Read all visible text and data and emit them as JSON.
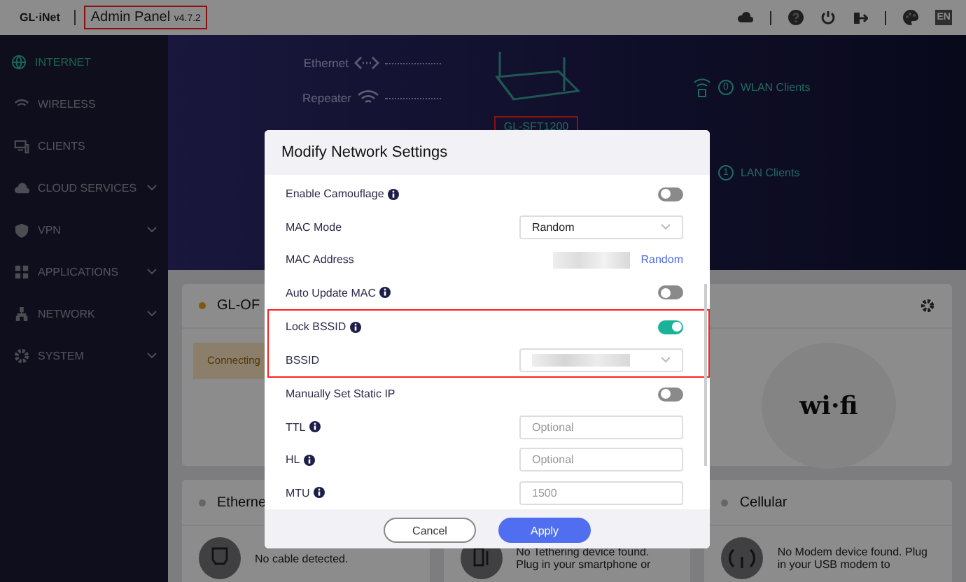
{
  "top_bar": {
    "logo": "GL·iNet",
    "title": "Admin Panel",
    "version": "v4.7.2",
    "highlighted": true,
    "language": "EN"
  },
  "sidebar": {
    "items": [
      {
        "label": "INTERNET",
        "selected": true,
        "expandable": false
      },
      {
        "label": "WIRELESS",
        "selected": false,
        "expandable": false
      },
      {
        "label": "CLIENTS",
        "selected": false,
        "expandable": false
      },
      {
        "label": "CLOUD SERVICES",
        "selected": false,
        "expandable": true
      },
      {
        "label": "VPN",
        "selected": false,
        "expandable": true
      },
      {
        "label": "APPLICATIONS",
        "selected": false,
        "expandable": true
      },
      {
        "label": "NETWORK",
        "selected": false,
        "expandable": true
      },
      {
        "label": "SYSTEM",
        "selected": false,
        "expandable": true
      }
    ]
  },
  "topology": {
    "links": [
      {
        "label": "Ethernet"
      },
      {
        "label": "Repeater"
      }
    ],
    "device": "GL-SFT1200",
    "device_highlighted": true,
    "clients": [
      {
        "count": "0",
        "label": "WLAN Clients"
      },
      {
        "count": "1",
        "label": "LAN Clients"
      }
    ]
  },
  "repeater_card": {
    "title": "GL-OF",
    "status": "Connecting",
    "logo": "wi·fi"
  },
  "panels": [
    {
      "title": "Etherne",
      "message": "No cable detected."
    },
    {
      "message": "No Tethering device found. Plug in your smartphone or"
    },
    {
      "title": "Cellular",
      "message": "No Modem device found. Plug in your USB modem to"
    }
  ],
  "dialog": {
    "title": "Modify Network Settings",
    "rows": [
      {
        "kind": "toggle",
        "label": "Enable Camouflage",
        "info": true,
        "on": false,
        "highlighted": false
      },
      {
        "kind": "select",
        "label": "MAC Mode",
        "value": "Random",
        "highlighted": false
      },
      {
        "kind": "redacted-link",
        "label": "MAC Address",
        "link": "Random",
        "highlighted": false
      },
      {
        "kind": "toggle",
        "label": "Auto Update MAC",
        "info": true,
        "on": false,
        "highlighted": false
      },
      {
        "kind": "toggle",
        "label": "Lock BSSID",
        "info": true,
        "on": true,
        "highlighted": true
      },
      {
        "kind": "redacted-select",
        "label": "BSSID",
        "highlighted": true
      },
      {
        "kind": "toggle",
        "label": "Manually Set Static IP",
        "info": false,
        "on": false,
        "highlighted": false
      },
      {
        "kind": "input",
        "label": "TTL",
        "info": true,
        "placeholder": "Optional",
        "highlighted": false
      },
      {
        "kind": "input",
        "label": "HL",
        "info": true,
        "placeholder": "Optional",
        "highlighted": false
      },
      {
        "kind": "input",
        "label": "MTU",
        "info": true,
        "placeholder": "1500",
        "highlighted": false
      }
    ],
    "buttons": [
      {
        "label": "Cancel",
        "kind": "secondary"
      },
      {
        "label": "Apply",
        "kind": "primary"
      }
    ]
  }
}
